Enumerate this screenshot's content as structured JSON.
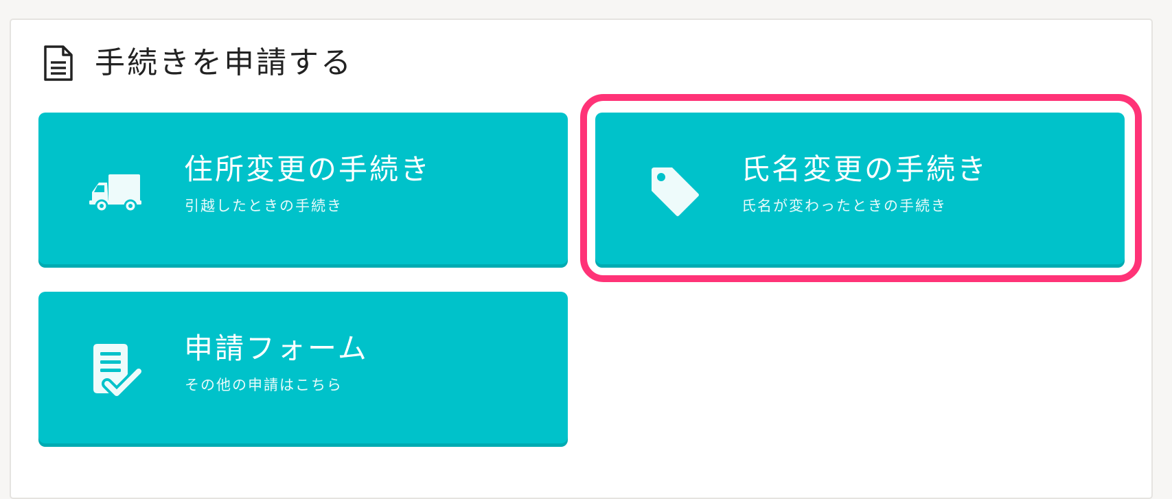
{
  "header": {
    "title": "手続きを申請する",
    "icon": "document-icon"
  },
  "cards": [
    {
      "title": "住所変更の手続き",
      "subtitle": "引越したときの手続き",
      "icon": "truck-icon"
    },
    {
      "title": "氏名変更の手続き",
      "subtitle": "氏名が変わったときの手続き",
      "icon": "tag-icon"
    },
    {
      "title": "申請フォーム",
      "subtitle": "その他の申請はこちら",
      "icon": "form-check-icon"
    }
  ],
  "colors": {
    "card_background": "#00c2ca",
    "card_shadow": "#00abb2",
    "highlight_border": "#ff3377",
    "page_background": "#f7f6f4",
    "panel_background": "#ffffff"
  }
}
